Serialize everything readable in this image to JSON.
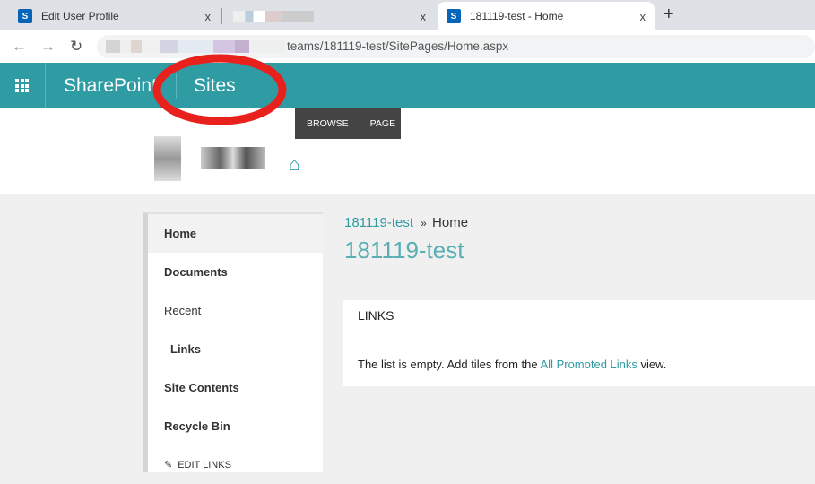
{
  "browser": {
    "tabs": [
      {
        "title": "Edit User Profile",
        "active": false
      },
      {
        "title": "",
        "active": false
      },
      {
        "title": "181119-test - Home",
        "active": true
      }
    ],
    "url_visible": "teams/181119-test/SitePages/Home.aspx",
    "close": "x",
    "new_tab": "+"
  },
  "suite": {
    "brand": "SharePoint",
    "sites": "Sites"
  },
  "ribbon": {
    "browse": "BROWSE",
    "page": "PAGE"
  },
  "nav": {
    "items": [
      {
        "label": "Home"
      },
      {
        "label": "Documents"
      },
      {
        "label": "Recent"
      },
      {
        "label": "Links"
      },
      {
        "label": "Site Contents"
      },
      {
        "label": "Recycle Bin"
      }
    ],
    "edit_links": "EDIT LINKS"
  },
  "main": {
    "breadcrumb_site": "181119-test",
    "breadcrumb_sep": "»",
    "breadcrumb_page": "Home",
    "title": "181119-test",
    "links": {
      "heading": "LINKS",
      "empty_pre": "The list is empty. Add tiles from the ",
      "empty_link": "All Promoted Links",
      "empty_post": " view."
    }
  },
  "colors": {
    "accent": "#2f9ba3",
    "annotation": "#e8211d"
  }
}
